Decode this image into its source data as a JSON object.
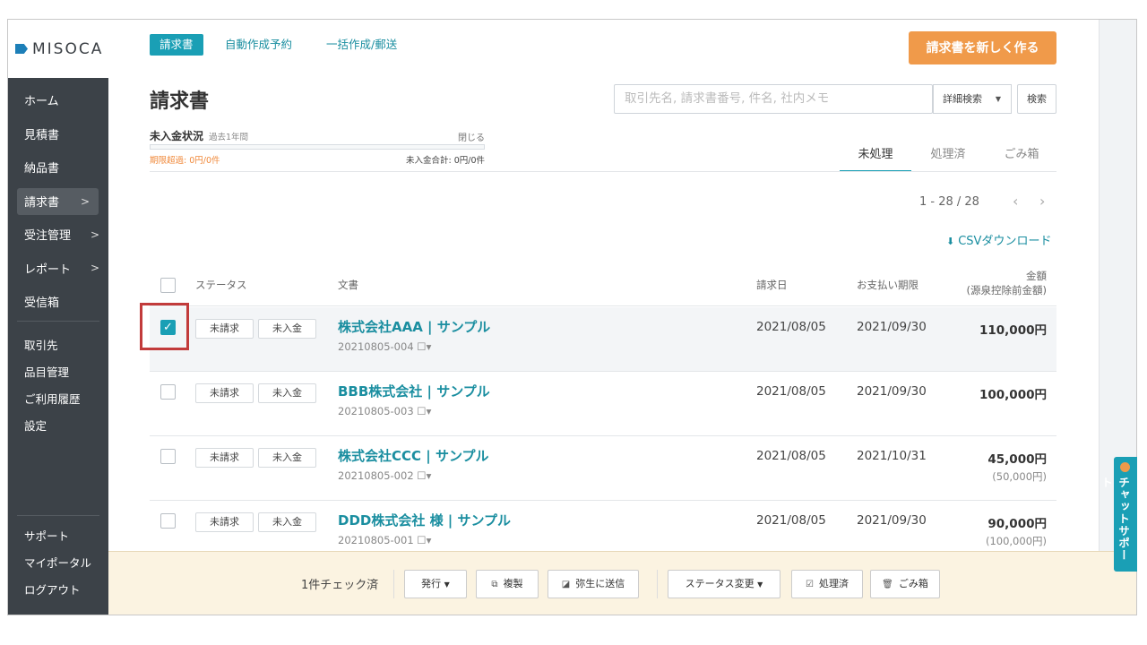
{
  "brand": {
    "name": "MISOCA"
  },
  "sidebar": {
    "items": [
      {
        "label": "ホーム"
      },
      {
        "label": "見積書"
      },
      {
        "label": "納品書"
      },
      {
        "label": "請求書",
        "chevron": ">"
      },
      {
        "label": "受注管理",
        "chevron": ">"
      },
      {
        "label": "レポート",
        "chevron": ">"
      },
      {
        "label": "受信箱"
      }
    ],
    "secondary": [
      "取引先",
      "品目管理",
      "ご利用履歴",
      "設定"
    ],
    "bottom": [
      "サポート",
      "マイポータル",
      "ログアウト"
    ]
  },
  "subtabs": [
    "請求書",
    "自動作成予約",
    "一括作成/郵送"
  ],
  "new_button": "請求書を新しく作る",
  "page_title": "請求書",
  "search": {
    "placeholder": "取引先名, 請求書番号, 件名, 社内メモ",
    "advanced": "詳細検索",
    "submit": "検索"
  },
  "unpaid": {
    "title": "未入金状況",
    "period": "過去1年間",
    "close": "閉じる",
    "overdue": "期限超過: 0円/0件",
    "total": "未入金合計: 0円/0件"
  },
  "filter_tabs": [
    "未処理",
    "処理済",
    "ごみ箱"
  ],
  "pagination": {
    "range": "1 - 28 / 28",
    "prev": "‹",
    "next": "›"
  },
  "csv_download": "CSVダウンロード",
  "table": {
    "headers": {
      "status": "ステータス",
      "document": "文書",
      "invoice_date": "請求日",
      "due_date": "お支払い期限",
      "amount": "金額",
      "amount_sub": "(源泉控除前金額)"
    },
    "rows": [
      {
        "checked": true,
        "status1": "未請求",
        "status2": "未入金",
        "title": "株式会社AAA | サンプル",
        "number": "20210805-004",
        "invoice_date": "2021/08/05",
        "due_date": "2021/09/30",
        "amount": "110,000円",
        "amount_sub": ""
      },
      {
        "checked": false,
        "status1": "未請求",
        "status2": "未入金",
        "title": "BBB株式会社 | サンプル",
        "number": "20210805-003",
        "invoice_date": "2021/08/05",
        "due_date": "2021/09/30",
        "amount": "100,000円",
        "amount_sub": ""
      },
      {
        "checked": false,
        "status1": "未請求",
        "status2": "未入金",
        "title": "株式会社CCC | サンプル",
        "number": "20210805-002",
        "invoice_date": "2021/08/05",
        "due_date": "2021/10/31",
        "amount": "45,000円",
        "amount_sub": "(50,000円)"
      },
      {
        "checked": false,
        "status1": "未請求",
        "status2": "未入金",
        "title": "DDD株式会社 様 | サンプル",
        "number": "20210805-001",
        "invoice_date": "2021/08/05",
        "due_date": "2021/09/30",
        "amount": "90,000円",
        "amount_sub": "(100,000円)"
      }
    ]
  },
  "bulk_bar": {
    "checked_count": "1件チェック済",
    "issue": "発行",
    "duplicate": "複製",
    "send_yayoi": "弥生に送信",
    "status_change": "ステータス変更",
    "processed": "処理済",
    "trash": "ごみ箱"
  },
  "chat_support": "チャットサポート",
  "colors": {
    "accent": "#1a9fb5",
    "brand_orange": "#f09a4a",
    "sidebar": "#3c4248",
    "highlight": "#c23b3b"
  }
}
